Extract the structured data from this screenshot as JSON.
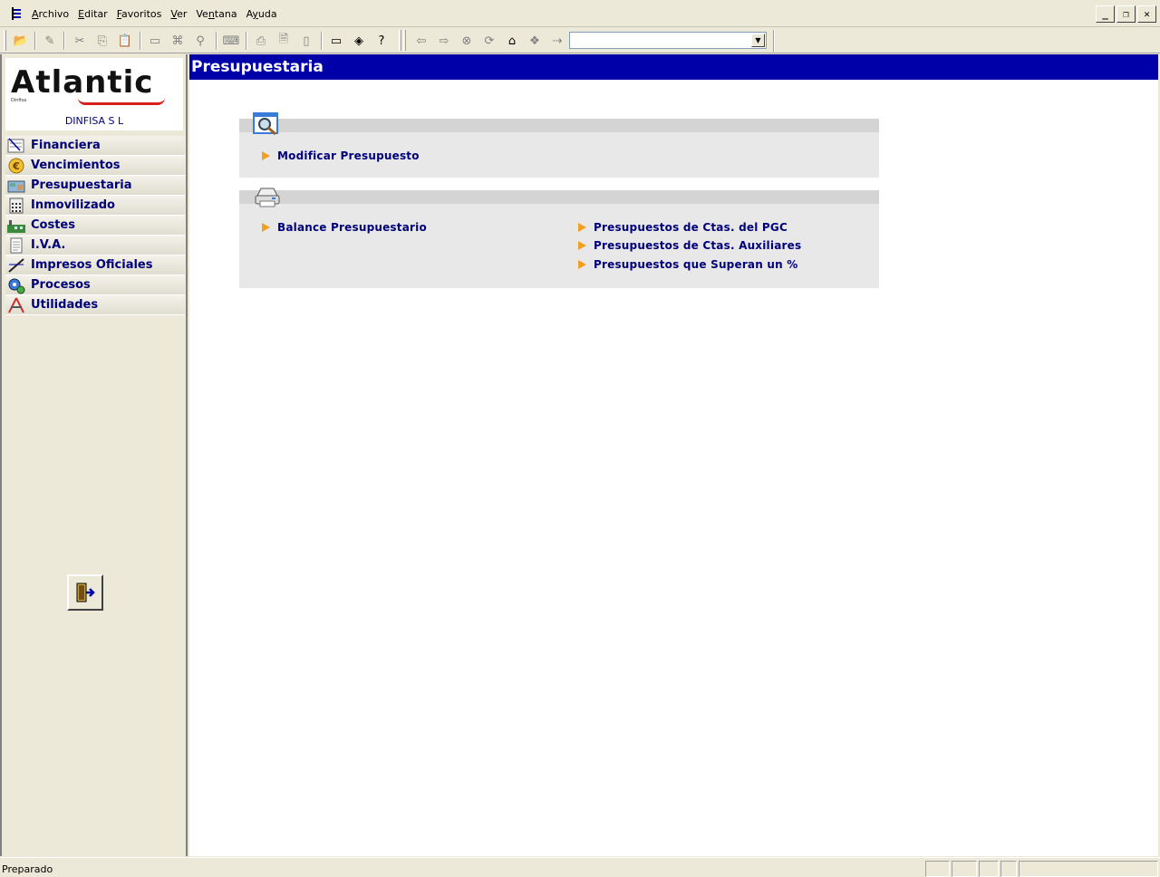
{
  "menubar": {
    "items": [
      {
        "label": "Archivo",
        "key": "A"
      },
      {
        "label": "Editar",
        "key": "E"
      },
      {
        "label": "Favoritos",
        "key": "F"
      },
      {
        "label": "Ver",
        "key": "V"
      },
      {
        "label": "Ventana",
        "key": "n"
      },
      {
        "label": "Ayuda",
        "key": "y"
      }
    ]
  },
  "window_controls": {
    "minimize": "_",
    "restore": "❐",
    "close": "✕"
  },
  "toolbar": {
    "address_value": "",
    "address_dropdown": "▼"
  },
  "sidebar": {
    "logo_text": "Atlantic",
    "logo_sub": "Dinfisa",
    "company": "DINFISA  S L",
    "items": [
      {
        "label": "Financiera",
        "icon": "ledger-icon"
      },
      {
        "label": "Vencimientos",
        "icon": "euro-icon"
      },
      {
        "label": "Presupuestaria",
        "icon": "budget-icon"
      },
      {
        "label": "Inmovilizado",
        "icon": "calculator-icon"
      },
      {
        "label": "Costes",
        "icon": "factory-icon"
      },
      {
        "label": "I.V.A.",
        "icon": "document-icon"
      },
      {
        "label": "Impresos Oficiales",
        "icon": "pen-icon"
      },
      {
        "label": "Procesos",
        "icon": "gears-icon"
      },
      {
        "label": "Utilidades",
        "icon": "tools-icon"
      }
    ]
  },
  "content": {
    "title": "Presupuestaria",
    "panel1": {
      "links": [
        "Modificar Presupuesto"
      ]
    },
    "panel2": {
      "left_links": [
        "Balance Presupuestario"
      ],
      "right_links": [
        "Presupuestos de Ctas. del PGC",
        "Presupuestos de Ctas. Auxiliares",
        "Presupuestos que Superan un %"
      ]
    }
  },
  "status": {
    "text": "Preparado"
  }
}
